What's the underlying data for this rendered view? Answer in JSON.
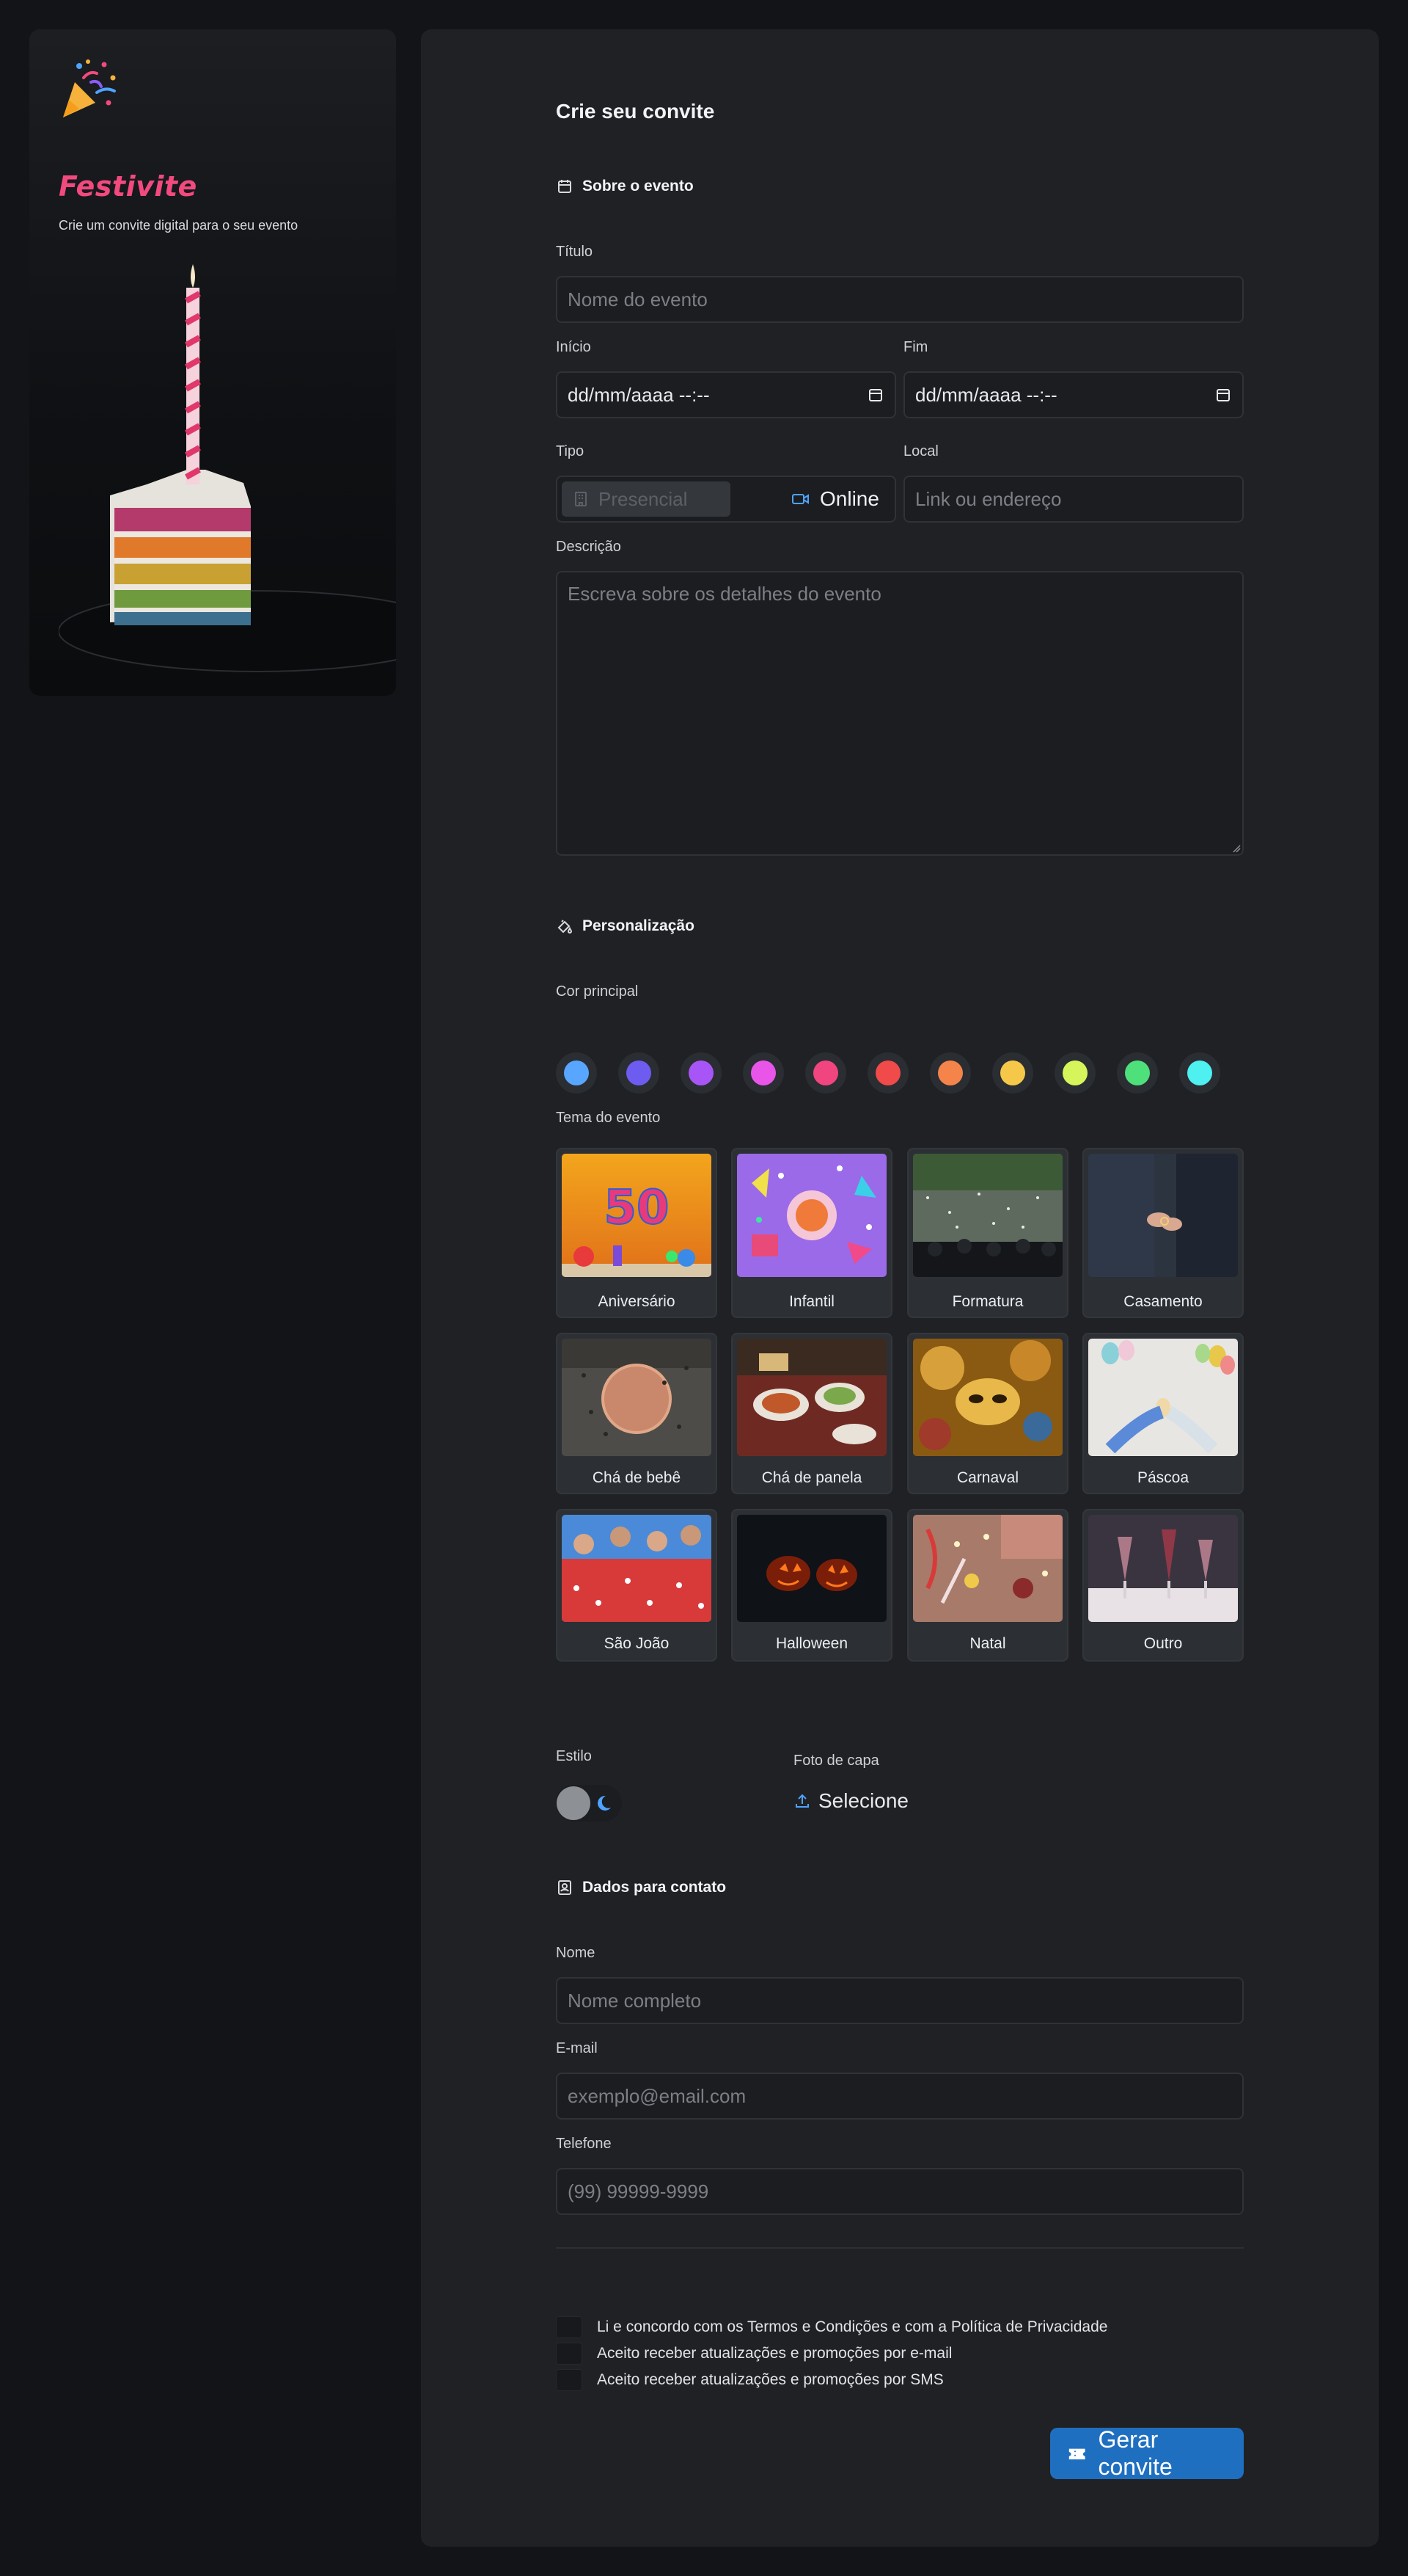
{
  "sidebar": {
    "brand": "Festivite",
    "tagline": "Crie um convite digital para o seu evento"
  },
  "form": {
    "heading": "Crie seu convite",
    "about": {
      "title": "Sobre o evento",
      "title_label": "Título",
      "title_placeholder": "Nome do evento",
      "start_label": "Início",
      "start_value": "dd/mm/aaaa --:--",
      "end_label": "Fim",
      "end_value": "dd/mm/aaaa --:--",
      "type_label": "Tipo",
      "type_options": [
        "Presencial",
        "Online"
      ],
      "type_selected": "Presencial",
      "location_label": "Local",
      "location_placeholder": "Link ou endereço",
      "description_label": "Descrição",
      "description_placeholder": "Escreva sobre os detalhes do evento"
    },
    "personalization": {
      "title": "Personalização",
      "color_label": "Cor principal",
      "colors": [
        "#58a6ff",
        "#6e5cf0",
        "#a855f7",
        "#e855e8",
        "#f0457e",
        "#f04a4a",
        "#f5844a",
        "#f5c84a",
        "#d6f55a",
        "#4ee07a",
        "#4ef0f0"
      ],
      "theme_label": "Tema do evento",
      "themes": [
        "Aniversário",
        "Infantil",
        "Formatura",
        "Casamento",
        "Chá de bebê",
        "Chá de panela",
        "Carnaval",
        "Páscoa",
        "São João",
        "Halloween",
        "Natal",
        "Outro"
      ],
      "style_label": "Estilo",
      "cover_label": "Foto de capa",
      "cover_action": "Selecione"
    },
    "contact": {
      "title": "Dados para contato",
      "name_label": "Nome",
      "name_placeholder": "Nome completo",
      "email_label": "E-mail",
      "email_placeholder": "exemplo@email.com",
      "phone_label": "Telefone",
      "phone_placeholder": "(99) 99999-9999"
    },
    "agreements": [
      "Li e concordo com os Termos e Condições e com a Política de Privacidade",
      "Aceito receber atualizações e promoções por e-mail",
      "Aceito receber atualizações e promoções por SMS"
    ],
    "submit_label": "Gerar convite",
    "accent_color": "#1f6fc1",
    "brand_color": "#f24a7e"
  }
}
